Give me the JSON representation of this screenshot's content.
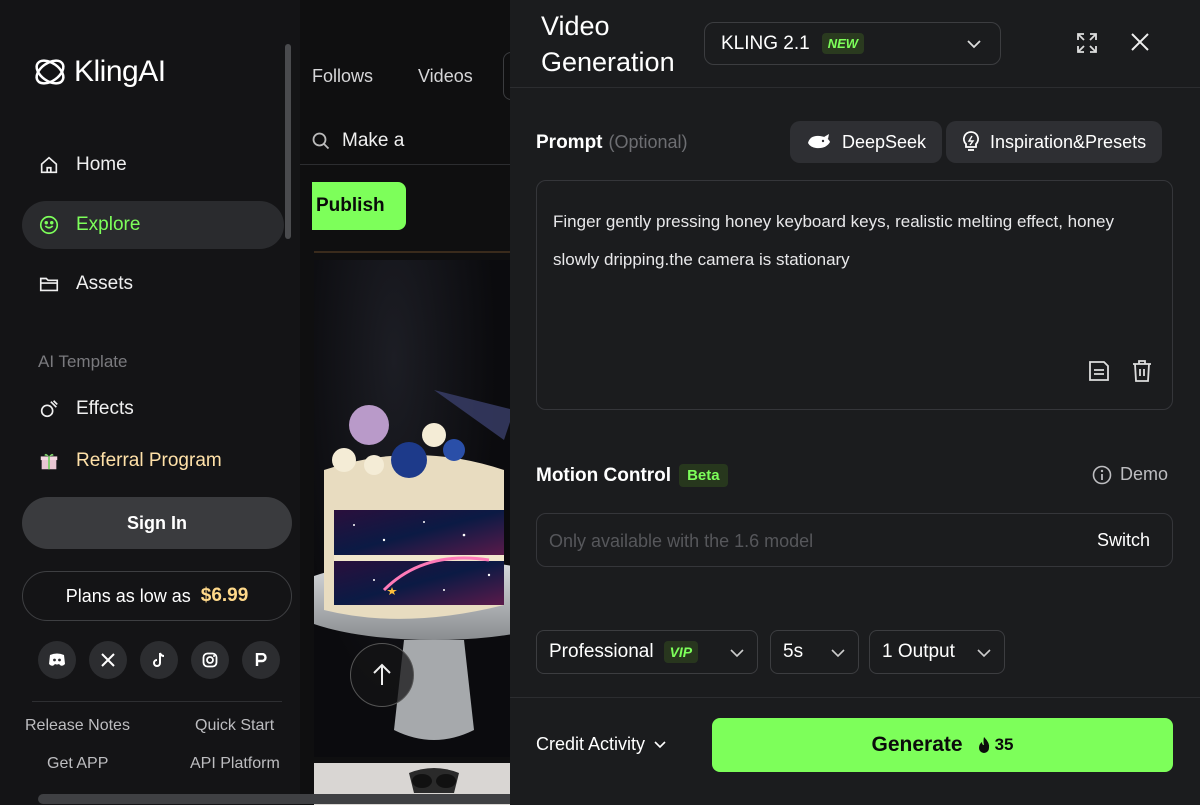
{
  "sidebar": {
    "logo_text": "KlingAI",
    "nav": [
      {
        "label": "Home",
        "icon": "home-icon"
      },
      {
        "label": "Explore",
        "icon": "explore-icon"
      },
      {
        "label": "Assets",
        "icon": "folder-icon"
      }
    ],
    "section_title": "AI Template",
    "template_items": [
      {
        "label": "Effects",
        "icon": "effects-icon"
      },
      {
        "label": "Referral Program",
        "icon": "gift-icon"
      }
    ],
    "sign_in_label": "Sign In",
    "plans_text": "Plans as low as",
    "plans_price": "$6.99",
    "socials": [
      "discord-icon",
      "x-icon",
      "tiktok-icon",
      "instagram-icon",
      "p-icon"
    ],
    "footer_links": [
      "Release Notes",
      "Quick Start",
      "Get APP",
      "API Platform"
    ],
    "accent": "#7dff5a"
  },
  "middle": {
    "tabs": [
      "Follows",
      "Videos"
    ],
    "search_text": "Make a",
    "publish_label": "Publish"
  },
  "panel": {
    "title": "Video Generation",
    "model": "KLING 2.1",
    "model_badge": "NEW",
    "prompt_label": "Prompt",
    "prompt_optional": "(Optional)",
    "deepseek_label": "DeepSeek",
    "presets_label": "Inspiration&Presets",
    "prompt_text": "Finger gently pressing honey keyboard keys, realistic melting effect, honey slowly dripping.the camera is stationary",
    "motion_label": "Motion Control",
    "motion_badge": "Beta",
    "demo_label": "Demo",
    "motion_placeholder": "Only available with the 1.6 model",
    "switch_label": "Switch",
    "mode": "Professional",
    "mode_badge": "VIP",
    "duration": "5s",
    "outputs": "1 Output",
    "credit_label": "Credit Activity",
    "generate_label": "Generate",
    "generate_cost": "35"
  }
}
